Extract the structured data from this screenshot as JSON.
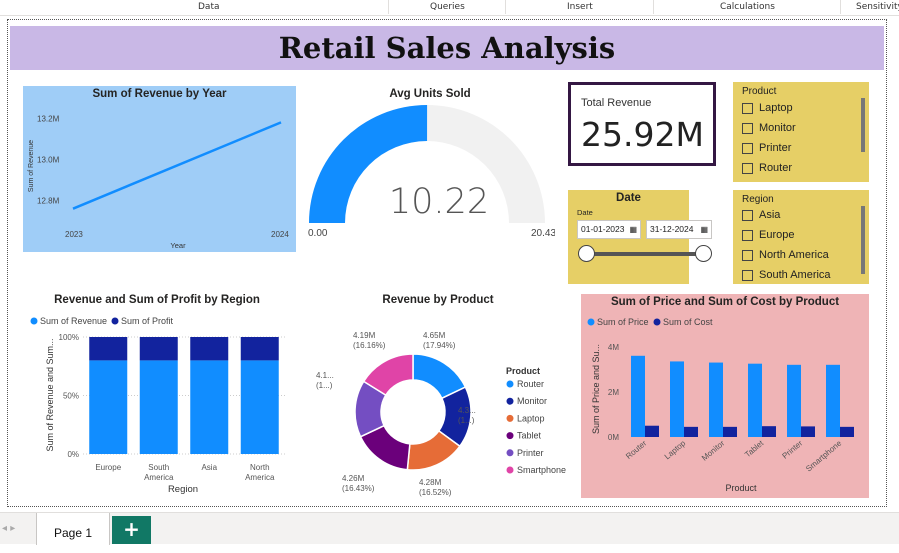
{
  "ribbon": {
    "items": [
      "Data",
      "Queries",
      "Insert",
      "Calculations",
      "Sensitivity"
    ]
  },
  "page_title": "Retail Sales Analysis",
  "card": {
    "label": "Total Revenue",
    "value": "25.92M"
  },
  "product_slicer": {
    "title": "Product",
    "items": [
      "Laptop",
      "Monitor",
      "Printer",
      "Router"
    ]
  },
  "region_slicer": {
    "title": "Region",
    "items": [
      "Asia",
      "Europe",
      "North America",
      "South America"
    ]
  },
  "date_slicer": {
    "title": "Date",
    "label": "Date",
    "start": "01-01-2023",
    "end": "31-12-2024"
  },
  "bottom": {
    "page_tab": "Page 1",
    "add_label": "+"
  },
  "colors": {
    "title_bg": "#c9b8e6",
    "line_bg": "#9fcdf7",
    "slicer_bg": "#e6cf66",
    "price_cost_bg": "#efb4b6",
    "primary_blue": "#118dff",
    "dark_navy": "#12239e",
    "gauge_bg": "#f1f1f1"
  },
  "chart_data": [
    {
      "id": "revenue-by-year",
      "type": "line",
      "title": "Sum of Revenue by Year",
      "xlabel": "Year",
      "ylabel": "Sum of Revenue",
      "x": [
        "2023",
        "2024"
      ],
      "series": [
        {
          "values": [
            12.76,
            13.18
          ]
        }
      ],
      "ylim": [
        12.7,
        13.25
      ],
      "yticks": [
        12.8,
        13.0,
        13.2
      ],
      "ytick_labels": [
        "12.8M",
        "13.0M",
        "13.2M"
      ],
      "grid": false
    },
    {
      "id": "avg-units-sold",
      "type": "gauge",
      "title": "Avg Units Sold",
      "value": 10.22,
      "value_label": "10.22",
      "min": 0,
      "max": 20.43,
      "min_label": "0.00",
      "max_label": "20.43"
    },
    {
      "id": "revenue-profit-by-region",
      "type": "bar",
      "stacked": "100%",
      "title": "Revenue and Sum of Profit by Region",
      "xlabel": "Region",
      "ylabel": "Sum of Revenue and Sum...",
      "categories": [
        "Europe",
        "South America",
        "Asia",
        "North America"
      ],
      "category_lines": [
        [
          "Europe"
        ],
        [
          "South",
          "America"
        ],
        [
          "Asia"
        ],
        [
          "North",
          "America"
        ]
      ],
      "series": [
        {
          "name": "Sum of Revenue",
          "values": [
            80,
            80,
            80,
            80
          ]
        },
        {
          "name": "Sum of Profit",
          "values": [
            20,
            20,
            20,
            20
          ]
        }
      ],
      "ylim": [
        0,
        100
      ],
      "yticks": [
        0,
        50,
        100
      ],
      "ytick_labels": [
        "0%",
        "50%",
        "100%"
      ],
      "legend": "top-left"
    },
    {
      "id": "revenue-by-product",
      "type": "pie",
      "donut": true,
      "title": "Revenue by Product",
      "legend_title": "Product",
      "legend": "right",
      "labels": [
        "Router",
        "Monitor",
        "Laptop",
        "Tablet",
        "Printer",
        "Smartphone"
      ],
      "values": [
        17.94,
        17.1,
        16.52,
        16.43,
        15.85,
        16.16
      ],
      "colors": [
        "#118dff",
        "#12239e",
        "#e66c37",
        "#6b007b",
        "#744ec2",
        "#e044a7"
      ],
      "data_labels": [
        [
          "4.65M",
          "(17.94%)"
        ],
        [
          "4.3...",
          "(1...)"
        ],
        [
          "4.28M",
          "(16.52%)"
        ],
        [
          "4.26M",
          "(16.43%)"
        ],
        [
          "4.1...",
          "(1...)"
        ],
        [
          "4.19M",
          "(16.16%)"
        ]
      ]
    },
    {
      "id": "price-cost-by-product",
      "type": "bar",
      "title": "Sum of Price and Sum of Cost by Product",
      "xlabel": "Product",
      "ylabel": "Sum of Price and Su...",
      "categories": [
        "Router",
        "Laptop",
        "Monitor",
        "Tablet",
        "Printer",
        "Smartphone"
      ],
      "series": [
        {
          "name": "Sum of Price",
          "values": [
            3.6,
            3.35,
            3.3,
            3.25,
            3.2,
            3.2
          ]
        },
        {
          "name": "Sum of Cost",
          "values": [
            0.5,
            0.45,
            0.45,
            0.48,
            0.47,
            0.45
          ]
        }
      ],
      "ylim": [
        0,
        4.3
      ],
      "yticks": [
        0,
        2,
        4
      ],
      "ytick_labels": [
        "0M",
        "2M",
        "4M"
      ],
      "legend": "top-left"
    }
  ]
}
